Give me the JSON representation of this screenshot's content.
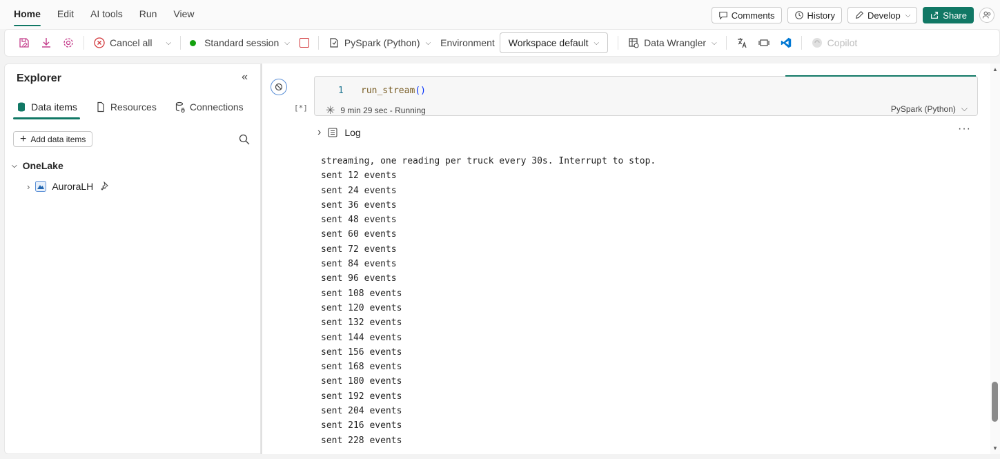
{
  "menu": {
    "items": [
      "Home",
      "Edit",
      "AI tools",
      "Run",
      "View"
    ],
    "active": "Home"
  },
  "topbar": {
    "comments_label": "Comments",
    "history_label": "History",
    "develop_label": "Develop",
    "share_label": "Share"
  },
  "ribbon": {
    "cancel_all_label": "Cancel all",
    "session_label": "Standard session",
    "language_label": "PySpark (Python)",
    "environment_label": "Environment",
    "workspace_label": "Workspace default",
    "data_wrangler_label": "Data Wrangler",
    "copilot_label": "Copilot"
  },
  "explorer": {
    "title": "Explorer",
    "tabs": [
      "Data items",
      "Resources",
      "Connections"
    ],
    "add_label": "Add data items",
    "tree_root": "OneLake",
    "tree_child": "AuroraLH"
  },
  "cell": {
    "exec_count": "[*]",
    "line_number": "1",
    "code_fn": "run_stream",
    "code_parens": "()",
    "status": "9 min 29 sec - Running",
    "language": "PySpark (Python)"
  },
  "log": {
    "label": "Log",
    "more": "···",
    "lines": [
      "streaming, one reading per truck every 30s. Interrupt to stop.",
      "sent 12 events",
      "sent 24 events",
      "sent 36 events",
      "sent 48 events",
      "sent 60 events",
      "sent 72 events",
      "sent 84 events",
      "sent 96 events",
      "sent 108 events",
      "sent 120 events",
      "sent 132 events",
      "sent 144 events",
      "sent 156 events",
      "sent 168 events",
      "sent 180 events",
      "sent 192 events",
      "sent 204 events",
      "sent 216 events",
      "sent 228 events"
    ]
  },
  "colors": {
    "accent": "#117865",
    "cancel_red": "#d13438",
    "session_green": "#13a10e",
    "vscode_blue": "#0078d4"
  }
}
